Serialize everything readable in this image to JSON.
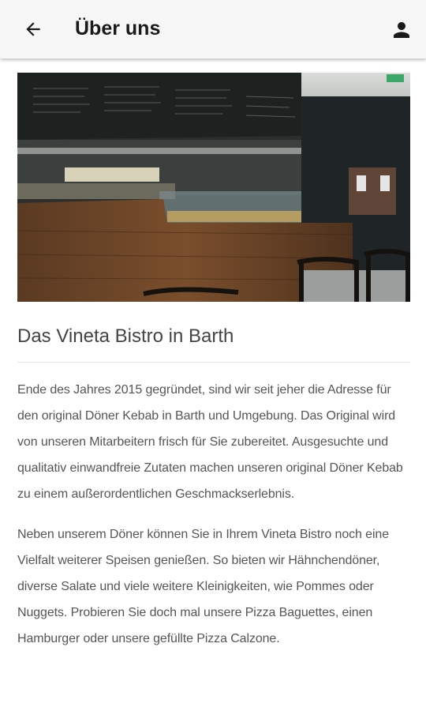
{
  "header": {
    "title": "Über uns",
    "back_icon": "arrow-left-icon",
    "user_icon": "user-icon"
  },
  "hero": {
    "description": "bistro-interior-photo"
  },
  "section": {
    "heading": "Das Vineta Bistro in Barth",
    "paragraphs": [
      "Ende des Jahres 2015 gegründet, sind wir seit jeher die Adresse für den original Döner Kebab in Barth und Umgebung. Das Original wird von unseren Mitarbeitern frisch für Sie zubereitet. Ausgesuchte und qualitativ einwandfreie Zutaten machen unseren original Döner Kebab zu einem außerordentlichen Geschmackserlebnis.",
      "Neben unserem Döner können Sie in Ihrem Vineta Bistro noch eine Vielfalt weiterer Speisen genießen. So bieten wir Hähnchendöner, diverse Salate und viele weitere Kleinigkeiten, wie Pommes oder Nuggets. Probieren Sie doch mal unsere Pizza Baguettes, einen Hamburger oder unsere gefüllte Pizza Calzone."
    ]
  }
}
